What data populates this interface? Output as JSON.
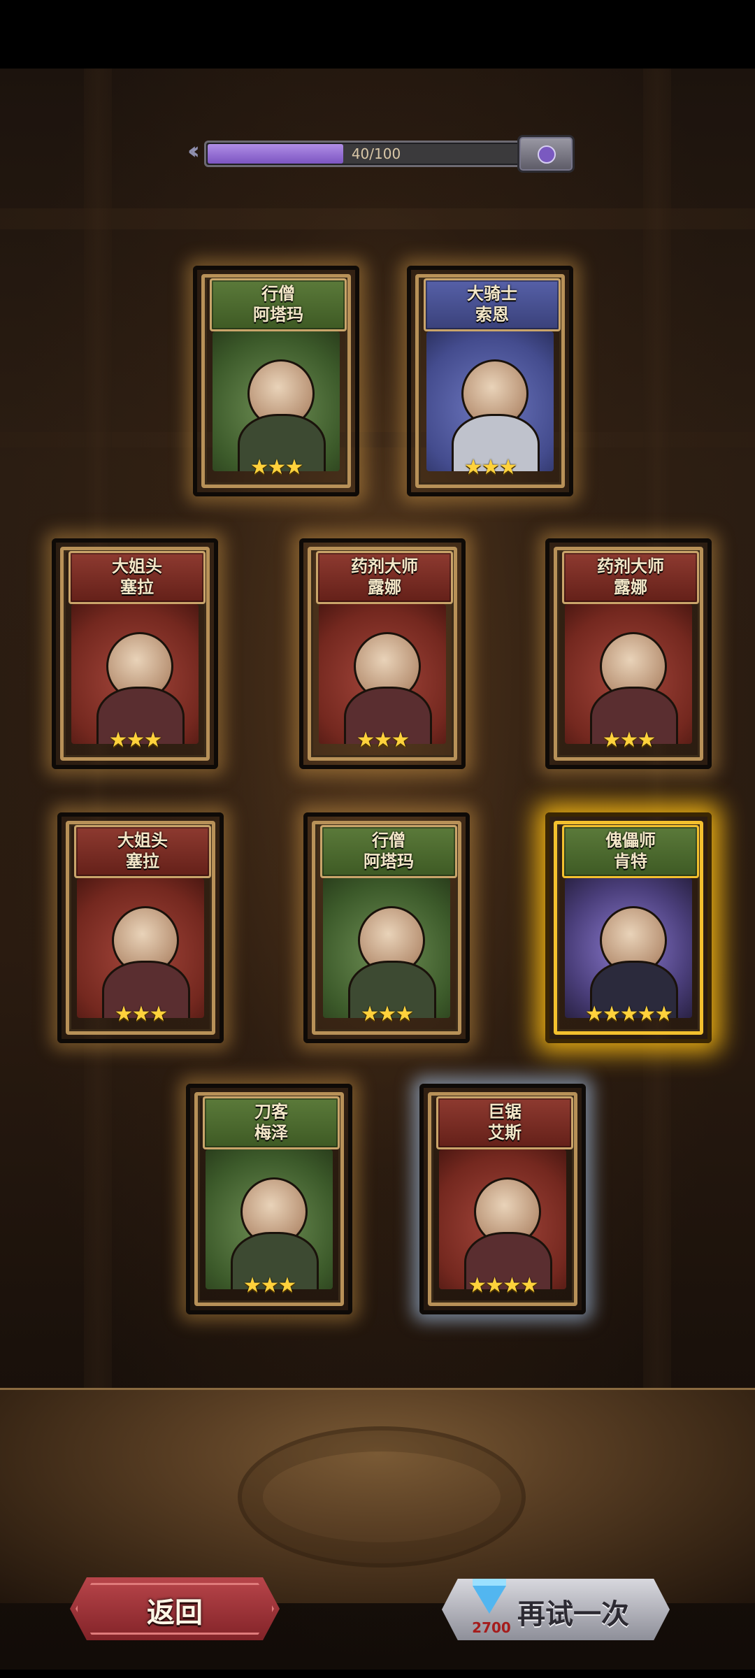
{
  "progress": {
    "label": "40/100",
    "fraction": 0.4
  },
  "cards": [
    {
      "title_line1": "行僧",
      "title_line2": "阿塔玛",
      "stars": "★★★",
      "theme": "green"
    },
    {
      "title_line1": "大骑士",
      "title_line2": "索恩",
      "stars": "★★★",
      "theme": "blue"
    },
    {
      "title_line1": "大姐头",
      "title_line2": "塞拉",
      "stars": "★★★",
      "theme": "red"
    },
    {
      "title_line1": "药剂大师",
      "title_line2": "露娜",
      "stars": "★★★",
      "theme": "red"
    },
    {
      "title_line1": "药剂大师",
      "title_line2": "露娜",
      "stars": "★★★",
      "theme": "red"
    },
    {
      "title_line1": "大姐头",
      "title_line2": "塞拉",
      "stars": "★★★",
      "theme": "red"
    },
    {
      "title_line1": "行僧",
      "title_line2": "阿塔玛",
      "stars": "★★★",
      "theme": "green"
    },
    {
      "title_line1": "傀儡师",
      "title_line2": "肯特",
      "stars": "★★★★★",
      "theme": "gold"
    },
    {
      "title_line1": "刀客",
      "title_line2": "梅泽",
      "stars": "★★★",
      "theme": "green"
    },
    {
      "title_line1": "巨锯",
      "title_line2": "艾斯",
      "stars": "★★★★",
      "theme": "red"
    }
  ],
  "buttons": {
    "back_label": "返回",
    "retry_label": "再试一次",
    "retry_cost": "2700",
    "retry_cost_icon": "diamond-icon"
  }
}
